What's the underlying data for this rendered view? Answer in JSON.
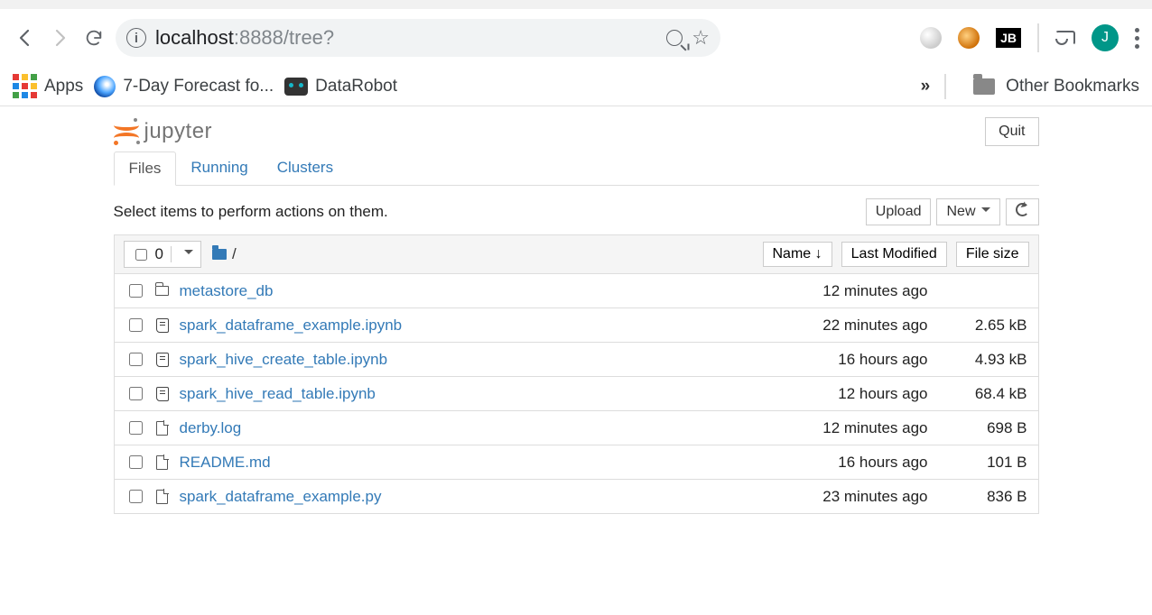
{
  "browser": {
    "url_host": "localhost",
    "url_port_path": ":8888/tree?",
    "avatar_letter": "J",
    "jb_label": "JB"
  },
  "bookmarks": {
    "apps_label": "Apps",
    "items": [
      {
        "label": "7-Day Forecast fo..."
      },
      {
        "label": "DataRobot"
      }
    ],
    "overflow": "»",
    "other_label": "Other Bookmarks"
  },
  "jupyter": {
    "logo_text": "jupyter",
    "quit_label": "Quit",
    "tabs": {
      "files": "Files",
      "running": "Running",
      "clusters": "Clusters"
    },
    "hint": "Select items to perform actions on them.",
    "upload_label": "Upload",
    "new_label": "New",
    "sel_count": "0",
    "breadcrumb_slash": "/",
    "col_name": "Name",
    "col_lastmod": "Last Modified",
    "col_filesize": "File size",
    "rows": [
      {
        "type": "folder",
        "name": "metastore_db",
        "modified": "12 minutes ago",
        "size": ""
      },
      {
        "type": "notebook",
        "name": "spark_dataframe_example.ipynb",
        "modified": "22 minutes ago",
        "size": "2.65 kB"
      },
      {
        "type": "notebook",
        "name": "spark_hive_create_table.ipynb",
        "modified": "16 hours ago",
        "size": "4.93 kB"
      },
      {
        "type": "notebook",
        "name": "spark_hive_read_table.ipynb",
        "modified": "12 hours ago",
        "size": "68.4 kB"
      },
      {
        "type": "file",
        "name": "derby.log",
        "modified": "12 minutes ago",
        "size": "698 B"
      },
      {
        "type": "file",
        "name": "README.md",
        "modified": "16 hours ago",
        "size": "101 B"
      },
      {
        "type": "file",
        "name": "spark_dataframe_example.py",
        "modified": "23 minutes ago",
        "size": "836 B"
      }
    ]
  }
}
